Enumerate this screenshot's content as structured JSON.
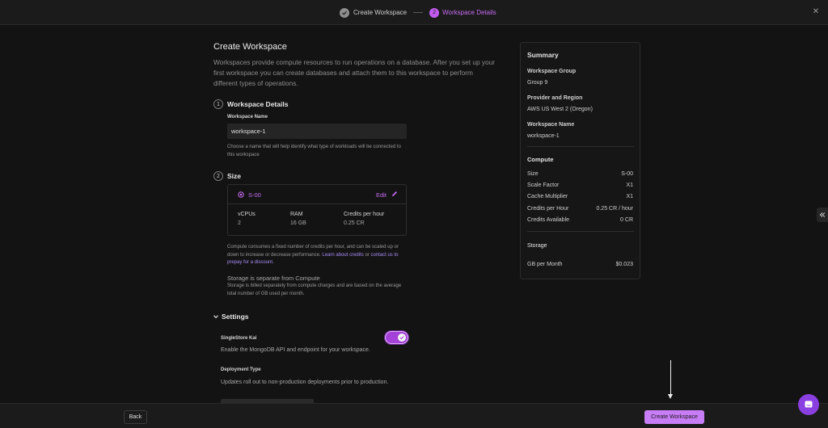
{
  "stepper": {
    "step1_label": "Create Workspace",
    "step2_number": "2",
    "step2_label": "Workspace Details",
    "close_glyph": "✕"
  },
  "page": {
    "title": "Create Workspace",
    "intro": "Workspaces provide compute resources to run operations on a database. After you set up your first workspace you can create databases and attach them to this workspace to perform different types of operations."
  },
  "details": {
    "number": "1",
    "title": "Workspace Details",
    "name_label": "Workspace Name",
    "name_value": "workspace-1",
    "name_help": "Choose a name that will help identify what type of workloads will be connected to this workspace"
  },
  "size": {
    "number": "2",
    "title": "Size",
    "selected": "S-00",
    "edit_label": "Edit",
    "specs": [
      {
        "label": "vCPUs",
        "value": "2"
      },
      {
        "label": "RAM",
        "value": "16 GB"
      },
      {
        "label": "Credits per hour",
        "value": "0.25 CR"
      }
    ],
    "compute_note_pre": "Compute consumes a fixed number of credits per hour, and can be scaled up or down to increase or decrease performance. ",
    "learn_link": "Learn about credits",
    "compute_note_mid": " or ",
    "contact_link": "contact us to prepay for a discount",
    "compute_note_end": ".",
    "storage_title": "Storage is separate from Compute",
    "storage_text": "Storage is billed separately from compute charges and are based on the average total number of GB used per month."
  },
  "settings": {
    "title": "Settings",
    "kai_label": "SingleStore Kai",
    "kai_desc": "Enable the MongoDB API and endpoint for your workspace.",
    "kai_enabled": true,
    "deploy_label": "Deployment Type",
    "deploy_desc": "Updates roll out to non-production deployments prior to production."
  },
  "summary": {
    "title": "Summary",
    "group_label": "Workspace Group",
    "group_value": "Group 9",
    "region_label": "Provider and Region",
    "region_value": "AWS US West 2 (Oregon)",
    "name_label": "Workspace Name",
    "name_value": "workspace-1",
    "compute_title": "Compute",
    "compute_rows": [
      {
        "label": "Size",
        "value": "S-00"
      },
      {
        "label": "Scale Factor",
        "value": "X1"
      },
      {
        "label": "Cache Multiplier",
        "value": "X1"
      },
      {
        "label": "Credits per Hour",
        "value": "0.25 CR / hour"
      },
      {
        "label": "Credits Available",
        "value": "0 CR"
      }
    ],
    "storage_title": "Storage",
    "storage_row": {
      "label": "GB per Month",
      "value": "$0.023"
    }
  },
  "footer": {
    "back_label": "Back",
    "create_label": "Create Workspace"
  },
  "colors": {
    "accent": "#c77df5",
    "accent_text": "#c96cf5",
    "background": "#131313"
  }
}
